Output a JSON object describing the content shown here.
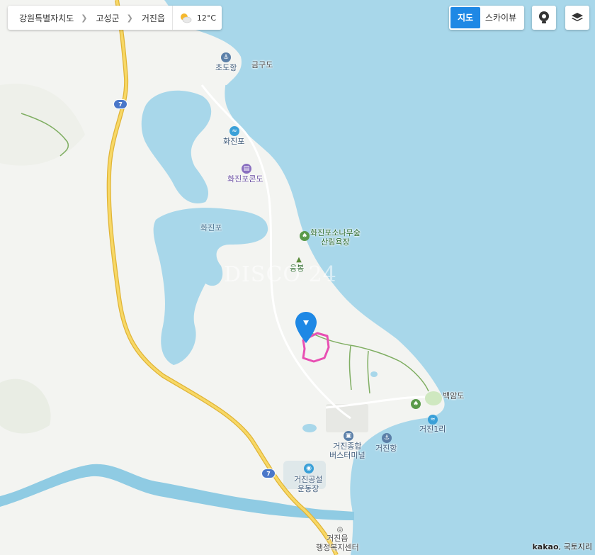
{
  "breadcrumb": {
    "items": [
      "강원특별자치도",
      "고성군",
      "거진읍"
    ],
    "separator": "❯"
  },
  "weather": {
    "icon": "partly-cloudy-icon",
    "temperature": "12°C"
  },
  "map_type": {
    "map_label": "지도",
    "skyview_label": "스카이뷰",
    "active": "지도"
  },
  "controls": {
    "roadview_icon": "roadview-pin-icon",
    "layers_icon": "layers-icon"
  },
  "labels": {
    "chodohang": "초도항",
    "geumgudo": "금구도",
    "hwajinpo_beach": "화진포",
    "hwajinpo_condo": "화진포콘도",
    "hwajinpo_lake": "화진포",
    "pine_forest_line1": "화진포소나무숲",
    "pine_forest_line2": "산림욕장",
    "ungbong": "응봉",
    "baegamdo": "백암도",
    "geojin1ri": "거진1리",
    "bus_terminal_line1": "거진종합",
    "bus_terminal_line2": "버스터미널",
    "geojinhang": "거진항",
    "stadium_line1": "거진공설",
    "stadium_line2": "운동장",
    "center_line1": "거진읍",
    "center_line2": "행정복지센터"
  },
  "highway": {
    "route_number": "7"
  },
  "watermark": "DISCO 24",
  "copyright": {
    "brand": "kakao",
    "text": ", 국토지리"
  },
  "colors": {
    "sea": "#a8d7ea",
    "land": "#f3f4f1",
    "highway": "#f2c744",
    "highway_badge": "#4a77c9",
    "parcel_outline": "#e84fb3",
    "marker": "#1e88e5",
    "active_tab": "#1e88e5"
  }
}
